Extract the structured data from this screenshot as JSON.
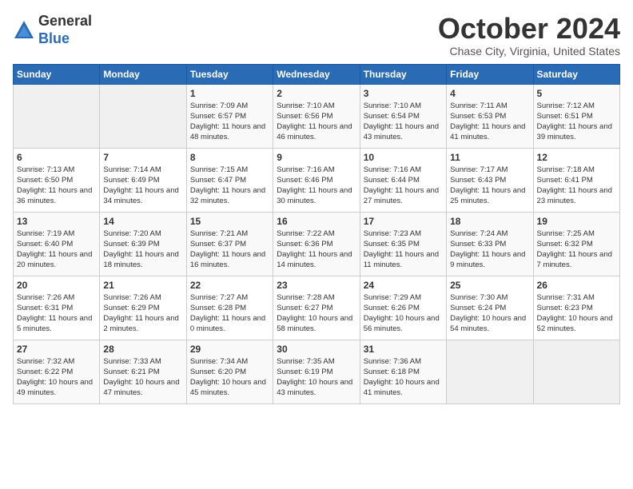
{
  "logo": {
    "general": "General",
    "blue": "Blue"
  },
  "header": {
    "month": "October 2024",
    "location": "Chase City, Virginia, United States"
  },
  "weekdays": [
    "Sunday",
    "Monday",
    "Tuesday",
    "Wednesday",
    "Thursday",
    "Friday",
    "Saturday"
  ],
  "weeks": [
    [
      {
        "day": null,
        "info": null
      },
      {
        "day": null,
        "info": null
      },
      {
        "day": "1",
        "info": "Sunrise: 7:09 AM\nSunset: 6:57 PM\nDaylight: 11 hours and 48 minutes."
      },
      {
        "day": "2",
        "info": "Sunrise: 7:10 AM\nSunset: 6:56 PM\nDaylight: 11 hours and 46 minutes."
      },
      {
        "day": "3",
        "info": "Sunrise: 7:10 AM\nSunset: 6:54 PM\nDaylight: 11 hours and 43 minutes."
      },
      {
        "day": "4",
        "info": "Sunrise: 7:11 AM\nSunset: 6:53 PM\nDaylight: 11 hours and 41 minutes."
      },
      {
        "day": "5",
        "info": "Sunrise: 7:12 AM\nSunset: 6:51 PM\nDaylight: 11 hours and 39 minutes."
      }
    ],
    [
      {
        "day": "6",
        "info": "Sunrise: 7:13 AM\nSunset: 6:50 PM\nDaylight: 11 hours and 36 minutes."
      },
      {
        "day": "7",
        "info": "Sunrise: 7:14 AM\nSunset: 6:49 PM\nDaylight: 11 hours and 34 minutes."
      },
      {
        "day": "8",
        "info": "Sunrise: 7:15 AM\nSunset: 6:47 PM\nDaylight: 11 hours and 32 minutes."
      },
      {
        "day": "9",
        "info": "Sunrise: 7:16 AM\nSunset: 6:46 PM\nDaylight: 11 hours and 30 minutes."
      },
      {
        "day": "10",
        "info": "Sunrise: 7:16 AM\nSunset: 6:44 PM\nDaylight: 11 hours and 27 minutes."
      },
      {
        "day": "11",
        "info": "Sunrise: 7:17 AM\nSunset: 6:43 PM\nDaylight: 11 hours and 25 minutes."
      },
      {
        "day": "12",
        "info": "Sunrise: 7:18 AM\nSunset: 6:41 PM\nDaylight: 11 hours and 23 minutes."
      }
    ],
    [
      {
        "day": "13",
        "info": "Sunrise: 7:19 AM\nSunset: 6:40 PM\nDaylight: 11 hours and 20 minutes."
      },
      {
        "day": "14",
        "info": "Sunrise: 7:20 AM\nSunset: 6:39 PM\nDaylight: 11 hours and 18 minutes."
      },
      {
        "day": "15",
        "info": "Sunrise: 7:21 AM\nSunset: 6:37 PM\nDaylight: 11 hours and 16 minutes."
      },
      {
        "day": "16",
        "info": "Sunrise: 7:22 AM\nSunset: 6:36 PM\nDaylight: 11 hours and 14 minutes."
      },
      {
        "day": "17",
        "info": "Sunrise: 7:23 AM\nSunset: 6:35 PM\nDaylight: 11 hours and 11 minutes."
      },
      {
        "day": "18",
        "info": "Sunrise: 7:24 AM\nSunset: 6:33 PM\nDaylight: 11 hours and 9 minutes."
      },
      {
        "day": "19",
        "info": "Sunrise: 7:25 AM\nSunset: 6:32 PM\nDaylight: 11 hours and 7 minutes."
      }
    ],
    [
      {
        "day": "20",
        "info": "Sunrise: 7:26 AM\nSunset: 6:31 PM\nDaylight: 11 hours and 5 minutes."
      },
      {
        "day": "21",
        "info": "Sunrise: 7:26 AM\nSunset: 6:29 PM\nDaylight: 11 hours and 2 minutes."
      },
      {
        "day": "22",
        "info": "Sunrise: 7:27 AM\nSunset: 6:28 PM\nDaylight: 11 hours and 0 minutes."
      },
      {
        "day": "23",
        "info": "Sunrise: 7:28 AM\nSunset: 6:27 PM\nDaylight: 10 hours and 58 minutes."
      },
      {
        "day": "24",
        "info": "Sunrise: 7:29 AM\nSunset: 6:26 PM\nDaylight: 10 hours and 56 minutes."
      },
      {
        "day": "25",
        "info": "Sunrise: 7:30 AM\nSunset: 6:24 PM\nDaylight: 10 hours and 54 minutes."
      },
      {
        "day": "26",
        "info": "Sunrise: 7:31 AM\nSunset: 6:23 PM\nDaylight: 10 hours and 52 minutes."
      }
    ],
    [
      {
        "day": "27",
        "info": "Sunrise: 7:32 AM\nSunset: 6:22 PM\nDaylight: 10 hours and 49 minutes."
      },
      {
        "day": "28",
        "info": "Sunrise: 7:33 AM\nSunset: 6:21 PM\nDaylight: 10 hours and 47 minutes."
      },
      {
        "day": "29",
        "info": "Sunrise: 7:34 AM\nSunset: 6:20 PM\nDaylight: 10 hours and 45 minutes."
      },
      {
        "day": "30",
        "info": "Sunrise: 7:35 AM\nSunset: 6:19 PM\nDaylight: 10 hours and 43 minutes."
      },
      {
        "day": "31",
        "info": "Sunrise: 7:36 AM\nSunset: 6:18 PM\nDaylight: 10 hours and 41 minutes."
      },
      {
        "day": null,
        "info": null
      },
      {
        "day": null,
        "info": null
      }
    ]
  ]
}
